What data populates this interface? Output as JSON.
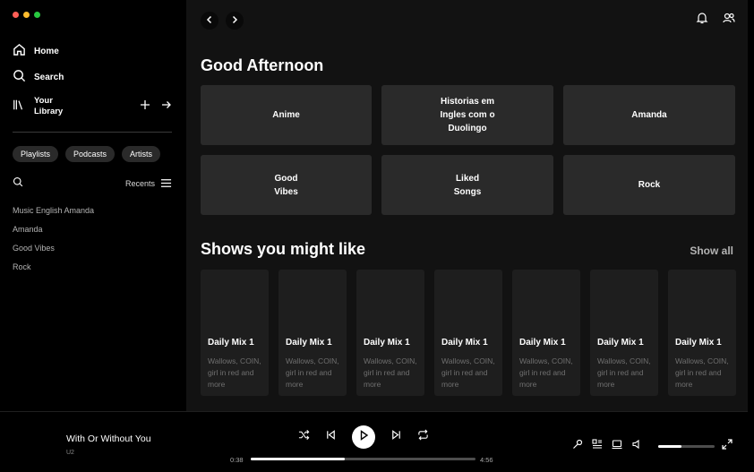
{
  "window": {
    "traffic_colors": [
      "#ff5f57",
      "#febc2e",
      "#28c840"
    ]
  },
  "sidebar": {
    "nav": [
      {
        "label": "Home",
        "icon": "home-icon"
      },
      {
        "label": "Search",
        "icon": "search-icon"
      }
    ],
    "library": {
      "line1": "Your",
      "line2": "Library",
      "icon": "library-icon"
    },
    "chips": [
      "Playlists",
      "Podcasts",
      "Artists"
    ],
    "recents_label": "Recents",
    "items": [
      "Music English Amanda",
      "Amanda",
      "Good Vibes",
      "Rock"
    ]
  },
  "main": {
    "greeting": "Good Afternoon",
    "quick_cards": [
      {
        "lines": [
          "Anime"
        ]
      },
      {
        "lines": [
          "Historias em",
          "Ingles com o",
          "Duolingo"
        ]
      },
      {
        "lines": [
          "Amanda"
        ]
      },
      {
        "lines": [
          "Good",
          "Vibes"
        ]
      },
      {
        "lines": [
          "Liked",
          "Songs"
        ]
      },
      {
        "lines": [
          "Rock"
        ]
      }
    ],
    "shows_title": "Shows you might like",
    "show_all": "Show all",
    "shows": [
      {
        "title": "Daily Mix 1",
        "desc": "Wallows, COIN, girl in red and more"
      },
      {
        "title": "Daily Mix 1",
        "desc": "Wallows, COIN, girl in red and more"
      },
      {
        "title": "Daily Mix 1",
        "desc": "Wallows, COIN, girl in red and more"
      },
      {
        "title": "Daily Mix 1",
        "desc": "Wallows, COIN, girl in red and more"
      },
      {
        "title": "Daily Mix 1",
        "desc": "Wallows, COIN, girl in red and more"
      },
      {
        "title": "Daily Mix 1",
        "desc": "Wallows, COIN, girl in red and more"
      },
      {
        "title": "Daily Mix 1",
        "desc": "Wallows, COIN, girl in red and more"
      }
    ]
  },
  "player": {
    "track_title": "With Or Without You",
    "artist": "U2",
    "elapsed": "0:38",
    "duration": "4:56",
    "progress": 0.42,
    "volume": 0.42
  }
}
